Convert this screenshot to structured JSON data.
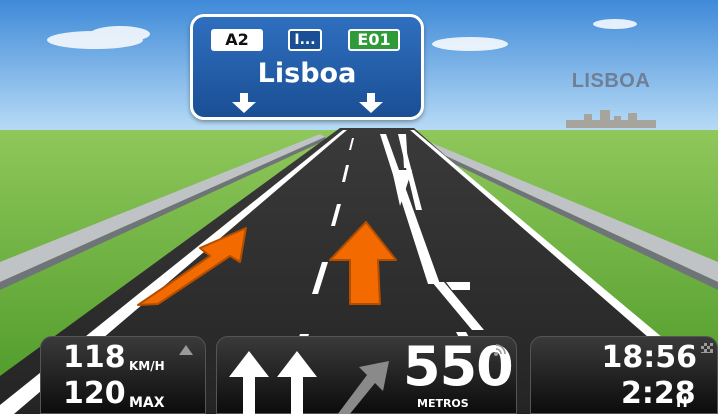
{
  "sign": {
    "road_shield": "A2",
    "exit_shield": "I...",
    "euro_shield": "E01",
    "destination": "Lisboa"
  },
  "skyline_label": "LISBOA",
  "speed_panel": {
    "speed": "118",
    "speed_unit": "KM/H",
    "limit": "120",
    "limit_unit": "MAX"
  },
  "instruction_panel": {
    "distance": "550",
    "distance_unit": "METROS",
    "lane_icons": [
      "straight-arrow-icon",
      "straight-arrow-icon",
      "bear-right-arrow-icon"
    ]
  },
  "time_panel": {
    "arrival": "18:56",
    "remaining": "2:28",
    "remaining_unit": "H"
  },
  "colors": {
    "sky": "#5a9fe0",
    "grass": "#5da830",
    "asphalt": "#2a2a2a",
    "guidance_arrow": "#f26a00",
    "sign_blue": "#1a4f95"
  }
}
